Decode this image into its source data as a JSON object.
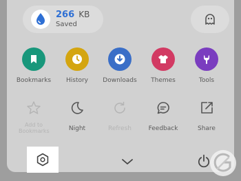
{
  "data_saved": {
    "amount": "266",
    "unit": "KB",
    "status": "Saved",
    "icon": "water-drop-icon",
    "accent": "#2e6fd4"
  },
  "top_right_icon": "ghost-icon",
  "shortcuts": [
    {
      "label": "Bookmarks",
      "icon": "bookmark-icon",
      "color": "#18977b"
    },
    {
      "label": "History",
      "icon": "clock-icon",
      "color": "#d4a510"
    },
    {
      "label": "Downloads",
      "icon": "download-icon",
      "color": "#3a6ec7"
    },
    {
      "label": "Themes",
      "icon": "shirt-icon",
      "color": "#d23a63"
    },
    {
      "label": "Tools",
      "icon": "wrench-icon",
      "color": "#7a3dbf"
    }
  ],
  "actions": [
    {
      "label": "Add to Bookmarks",
      "icon": "star-icon",
      "enabled": false
    },
    {
      "label": "Night",
      "icon": "moon-icon",
      "enabled": true
    },
    {
      "label": "Refresh",
      "icon": "refresh-icon",
      "enabled": false
    },
    {
      "label": "Feedback",
      "icon": "feedback-icon",
      "enabled": true
    },
    {
      "label": "Share",
      "icon": "share-icon",
      "enabled": true
    }
  ],
  "bottom_bar": {
    "settings_icon": "settings-hexagon-icon",
    "collapse_icon": "chevron-down-icon",
    "power_icon": "power-icon"
  }
}
